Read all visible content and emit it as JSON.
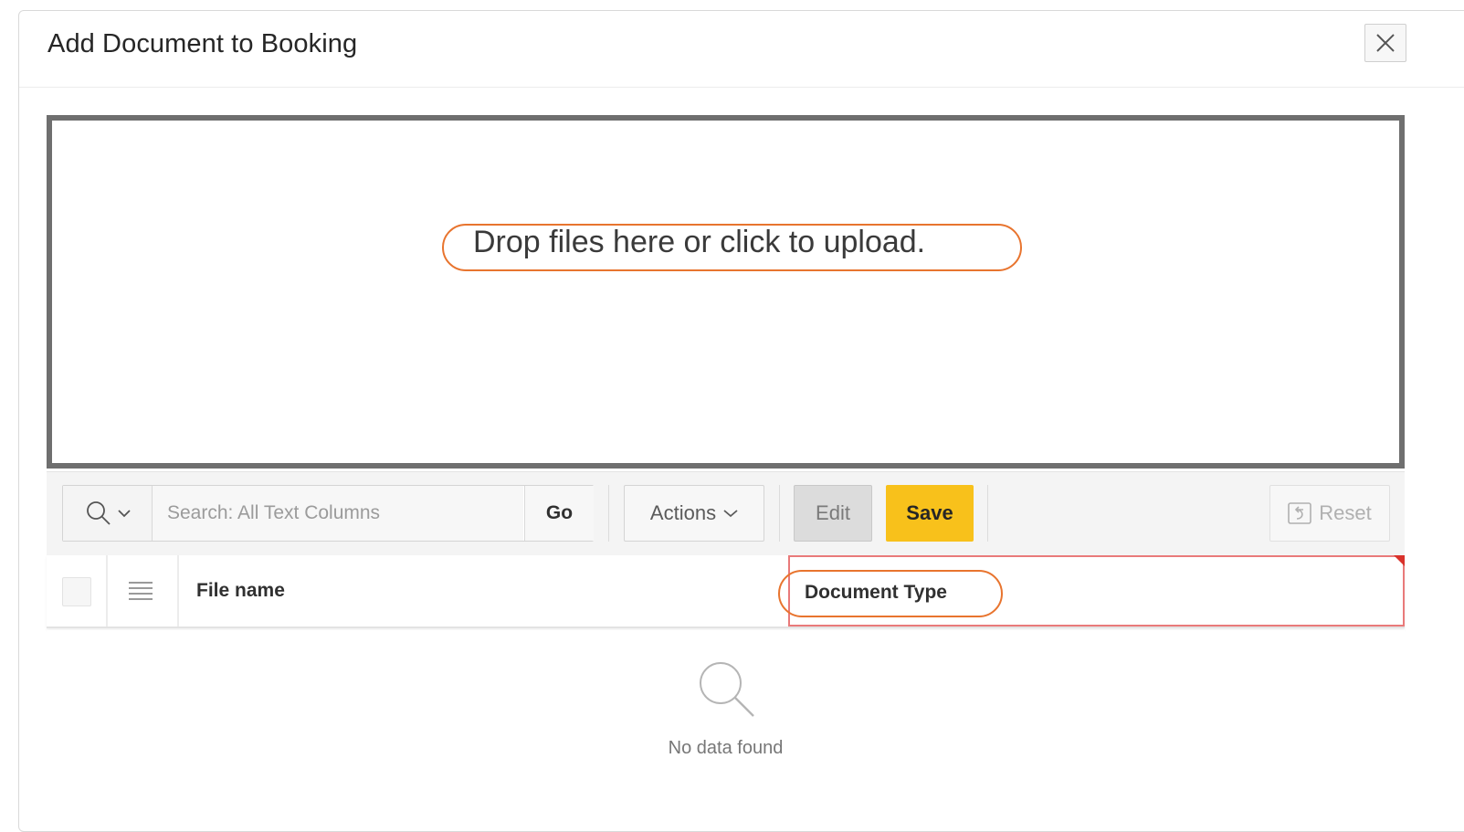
{
  "dialog": {
    "title": "Add Document to Booking",
    "close_icon": "close-icon"
  },
  "dropzone": {
    "text": "Drop files here or click to upload."
  },
  "toolbar": {
    "search_menu_icon": "search-icon",
    "search_placeholder": "Search: All Text Columns",
    "search_value": "",
    "go_label": "Go",
    "actions_label": "Actions",
    "edit_label": "Edit",
    "save_label": "Save",
    "reset_label": "Reset",
    "save_color": "#f8c11b"
  },
  "grid": {
    "columns": [
      {
        "label": "File name"
      },
      {
        "label": "Document Type",
        "required": true
      }
    ],
    "empty_message": "No data found"
  },
  "annotations": {
    "highlight_color": "#e8742e"
  }
}
